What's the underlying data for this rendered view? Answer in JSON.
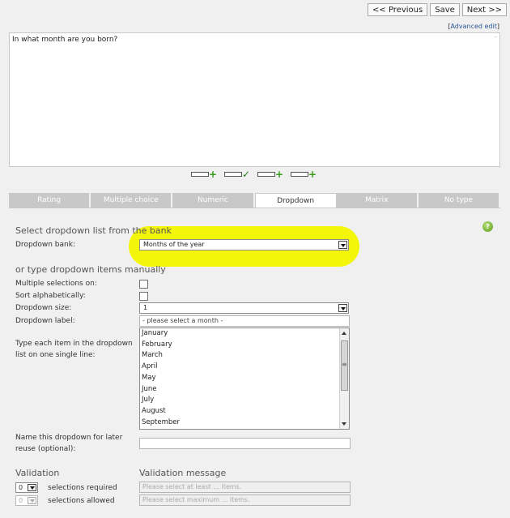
{
  "nav": {
    "previous": "<< Previous",
    "save": "Save",
    "next": "Next >>"
  },
  "advanced_edit": "Advanced edit",
  "question": {
    "text": "In what month are you born?"
  },
  "toolbar_icons": [
    "add-row-icon",
    "edit-row-icon",
    "add-column-icon",
    "add-table-icon"
  ],
  "tabs": [
    "Rating",
    "Multiple choice",
    "Numeric",
    "Dropdown",
    "Matrix",
    "No type"
  ],
  "active_tab": "Dropdown",
  "bank_section": {
    "heading": "Select dropdown list from the bank",
    "label": "Dropdown bank:",
    "selected": "Months of the year"
  },
  "manual_section": {
    "heading": "or type dropdown items manually",
    "multiple_label": "Multiple selections on:",
    "sort_label": "Sort alphabetically:",
    "size_label": "Dropdown size:",
    "size_value": "1",
    "dropdown_label_label": "Dropdown label:",
    "dropdown_label_value": "- please select a month -",
    "items_label_line1": "Type each item in the dropdown",
    "items_label_line2": "list on one single line:",
    "items": [
      "January",
      "February",
      "March",
      "April",
      "May",
      "June",
      "July",
      "August",
      "September"
    ],
    "name_label_line1": "Name this dropdown for later",
    "name_label_line2": "reuse (optional):",
    "name_value": ""
  },
  "validation": {
    "heading": "Validation",
    "message_heading": "Validation message",
    "required_value": "0",
    "required_label": "selections required",
    "required_placeholder": "Please select at least ... items.",
    "allowed_value": "0",
    "allowed_label": "selections allowed",
    "allowed_placeholder": "Please select maximum ... items."
  },
  "colors": {
    "highlight": "#f4f60a",
    "tab_inactive": "#c8c8c8",
    "help": "#5a9a1c"
  }
}
